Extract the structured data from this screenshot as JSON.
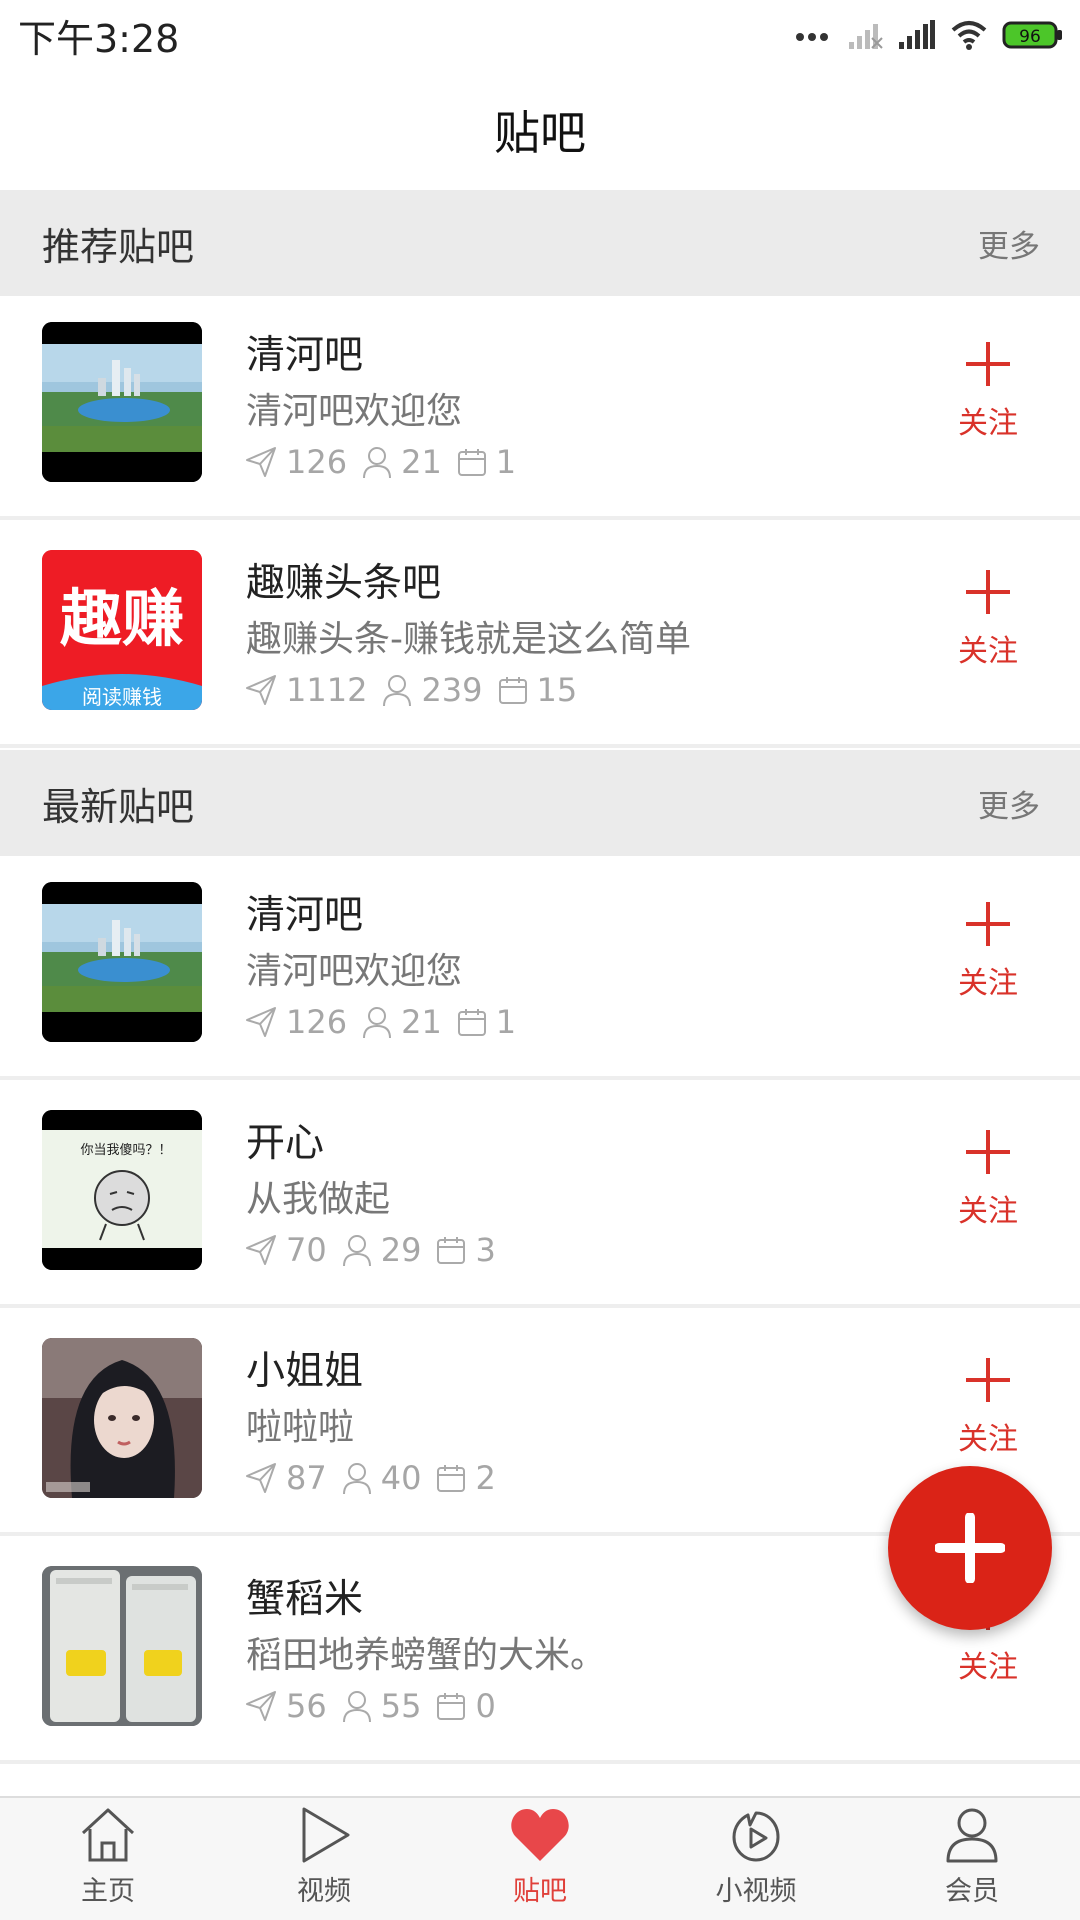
{
  "status_bar": {
    "time": "下午3:28",
    "battery": "96"
  },
  "header": {
    "title": "贴吧"
  },
  "sections": [
    {
      "title": "推荐贴吧",
      "more": "更多",
      "items": [
        {
          "name": "清河吧",
          "desc": "清河吧欢迎您",
          "posts": "126",
          "members": "21",
          "days": "1",
          "follow_label": "关注"
        },
        {
          "name": "趣赚头条吧",
          "desc": "趣赚头条-赚钱就是这么简单",
          "posts": "1112",
          "members": "239",
          "days": "15",
          "follow_label": "关注",
          "logo_text": "趣赚",
          "logo_sub": "阅读赚钱"
        }
      ]
    },
    {
      "title": "最新贴吧",
      "more": "更多",
      "items": [
        {
          "name": "清河吧",
          "desc": "清河吧欢迎您",
          "posts": "126",
          "members": "21",
          "days": "1",
          "follow_label": "关注"
        },
        {
          "name": "开心",
          "desc": "从我做起",
          "posts": "70",
          "members": "29",
          "days": "3",
          "follow_label": "关注",
          "meme_caption": "你当我傻吗？！"
        },
        {
          "name": "小姐姐",
          "desc": "啦啦啦",
          "posts": "87",
          "members": "40",
          "days": "2",
          "follow_label": "关注"
        },
        {
          "name": "蟹稻米",
          "desc": "稻田地养螃蟹的大米。",
          "posts": "56",
          "members": "55",
          "days": "0",
          "follow_label": "关注"
        }
      ]
    }
  ],
  "bottom_nav": [
    {
      "label": "主页",
      "icon": "home-icon"
    },
    {
      "label": "视频",
      "icon": "play-icon"
    },
    {
      "label": "贴吧",
      "icon": "heart-icon",
      "active": true
    },
    {
      "label": "小视频",
      "icon": "short-video-icon"
    },
    {
      "label": "会员",
      "icon": "user-icon"
    }
  ],
  "colors": {
    "accent": "#d9322a",
    "fab": "#da2317",
    "section_bg": "#ebebeb",
    "battery": "#4cc629"
  }
}
